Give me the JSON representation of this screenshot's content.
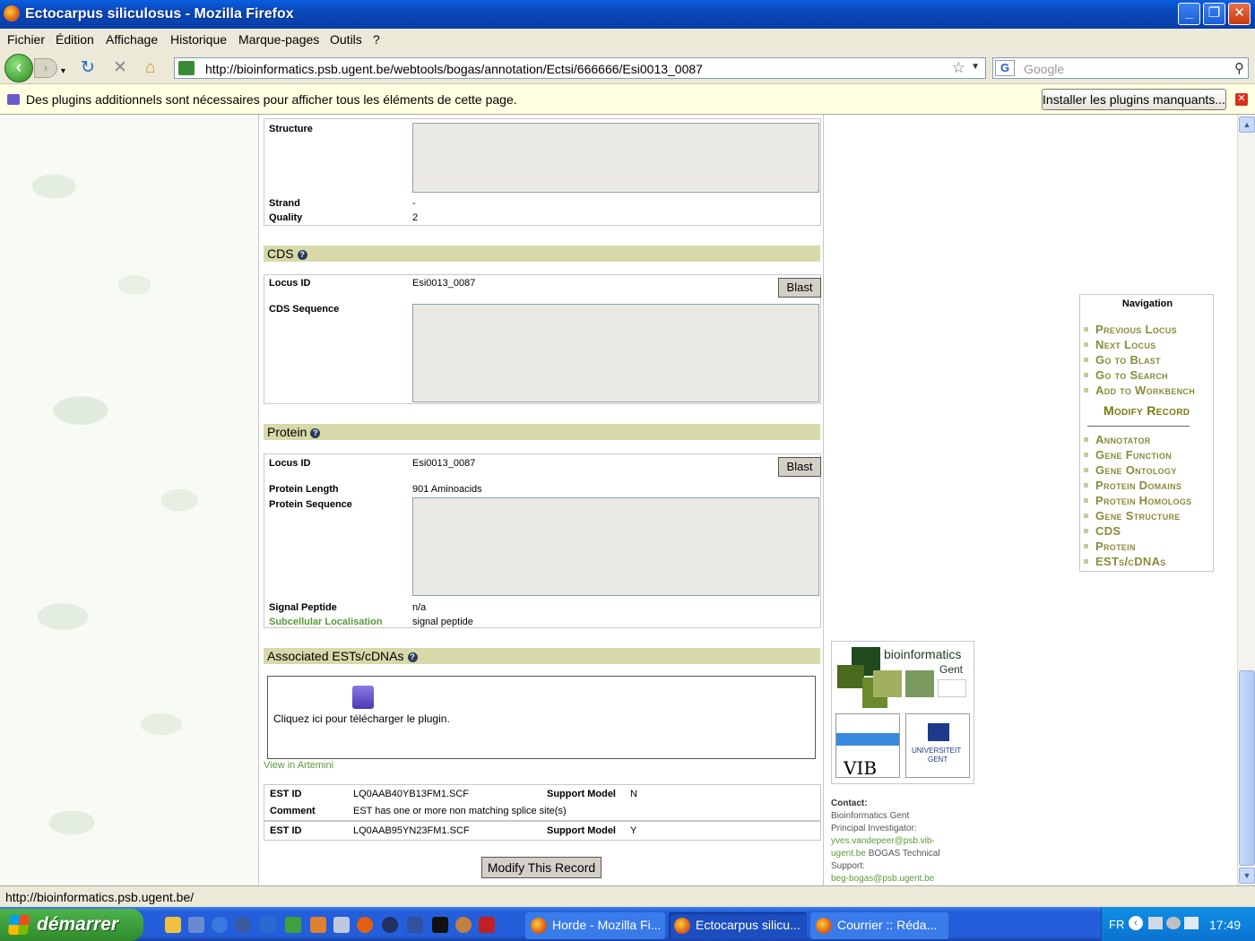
{
  "window": {
    "title": "Ectocarpus siliculosus - Mozilla Firefox"
  },
  "menu": [
    "Fichier",
    "Édition",
    "Affichage",
    "Historique",
    "Marque-pages",
    "Outils",
    "?"
  ],
  "toolbar": {
    "url": "http://bioinformatics.psb.ugent.be/webtools/bogas/annotation/Ectsi/666666/Esi0013_0087",
    "search_placeholder": "Google"
  },
  "pluginbar": {
    "message": "Des plugins additionnels sont nécessaires pour afficher tous les éléments de cette page.",
    "install_label": "Installer les plugins manquants..."
  },
  "structure": {
    "structure_label": "Structure",
    "strand_label": "Strand",
    "strand_value": "-",
    "quality_label": "Quality",
    "quality_value": "2"
  },
  "cds": {
    "heading": "CDS",
    "locus_label": "Locus ID",
    "locus_value": "Esi0013_0087",
    "blast_label": "Blast",
    "sequence_label": "CDS Sequence"
  },
  "protein": {
    "heading": "Protein",
    "locus_label": "Locus ID",
    "locus_value": "Esi0013_0087",
    "blast_label": "Blast",
    "length_label": "Protein Length",
    "length_value": "901 Aminoacids",
    "sequence_label": "Protein Sequence",
    "signal_label": "Signal Peptide",
    "signal_value": "n/a",
    "localisation_label": "Subcellular Localisation",
    "localisation_value": "signal peptide"
  },
  "ests": {
    "heading": "Associated ESTs/cDNAs",
    "plugin_text": "Cliquez ici pour télécharger le plugin.",
    "artemis_link": "View in Artemini",
    "est_label": "EST ID",
    "support_label": "Support Model",
    "comment_label": "Comment",
    "rows": [
      {
        "id": "LQ0AAB40YB13FM1.SCF",
        "support": "N",
        "comment": "EST has one or more non matching splice site(s)"
      },
      {
        "id": "LQ0AAB95YN23FM1.SCF",
        "support": "Y"
      }
    ],
    "modify_label": "Modify This Record"
  },
  "navigation": {
    "title": "Navigation",
    "items": [
      "Previous Locus",
      "Next Locus",
      "Go to Blast",
      "Go to Search",
      "Add to Workbench"
    ],
    "modify": "Modify Record",
    "sections": [
      "Annotator",
      "Gene Function",
      "Gene Ontology",
      "Protein Domains",
      "Protein Homologs",
      "Gene Structure",
      "CDS",
      "Protein",
      "ESTs/cDNAs"
    ]
  },
  "logo": {
    "line1": "bioinformatics",
    "line2": "Gent",
    "vib": "VIB",
    "ugent1": "UNIVERSITEIT",
    "ugent2": "GENT"
  },
  "contact": {
    "label": "Contact:",
    "org": "Bioinformatics Gent",
    "pi_label": "Principal Investigator:",
    "pi_email_1": "yves.vandepeer@psb.vib-",
    "pi_email_2": "ugent.be",
    "tech_label": "BOGAS Technical Support:",
    "support_email": "beg-bogas@psb.ugent.be"
  },
  "status": {
    "text": "http://bioinformatics.psb.ugent.be/"
  },
  "taskbar": {
    "start": "démarrer",
    "tasks": [
      "Horde - Mozilla Fi...",
      "Ectocarpus silicu...",
      "Courrier :: Réda..."
    ],
    "lang": "FR",
    "clock": "17:49"
  },
  "colors": {
    "section_header": "#d8d9a8",
    "nav_link": "#8a8a3a",
    "accent_green": "#5a9a3a"
  }
}
